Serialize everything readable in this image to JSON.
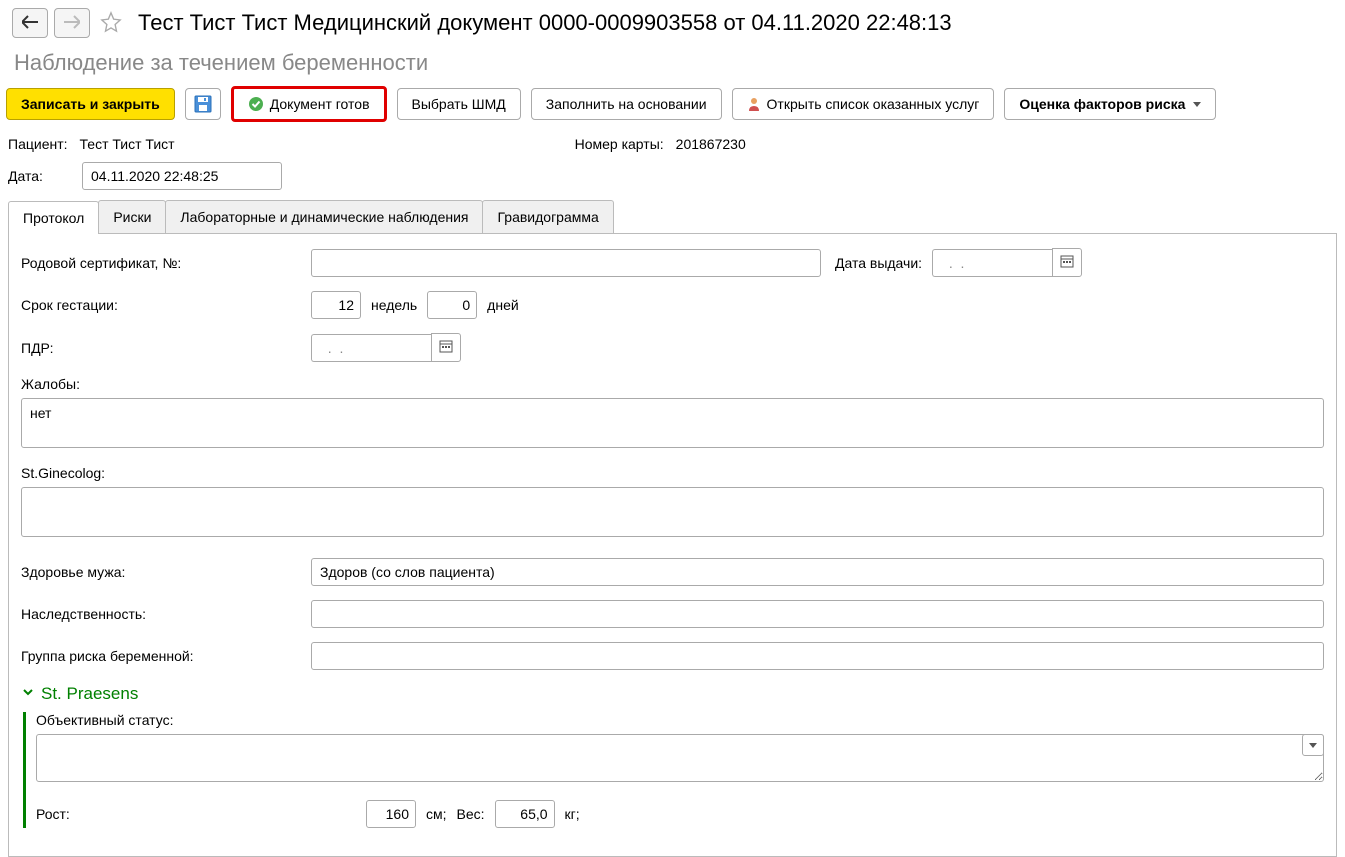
{
  "header": {
    "title": "Тест Тист Тист Медицинский документ 0000-0009903558 от 04.11.2020 22:48:13",
    "subtitle": "Наблюдение за течением беременности"
  },
  "toolbar": {
    "save_close": "Записать и закрыть",
    "doc_ready": "Документ готов",
    "select_shmd": "Выбрать ШМД",
    "fill_based": "Заполнить на основании",
    "open_services": "Открыть список оказанных услуг",
    "risk_assessment": "Оценка факторов риска"
  },
  "patient": {
    "label": "Пациент:",
    "value": "Тест Тист Тист",
    "card_label": "Номер карты:",
    "card_value": "201867230",
    "date_label": "Дата:",
    "date_value": "04.11.2020 22:48:25"
  },
  "tabs": {
    "protocol": "Протокол",
    "risks": "Риски",
    "lab": "Лабораторные и динамические наблюдения",
    "gravid": "Гравидограмма"
  },
  "form": {
    "cert_label": "Родовой сертификат, №:",
    "cert_value": "",
    "issue_date_label": "Дата выдачи:",
    "issue_date_value": "  .  .    ",
    "gest_label": "Срок гестации:",
    "gest_weeks": "12",
    "weeks_unit": "недель",
    "gest_days": "0",
    "days_unit": "дней",
    "pdr_label": "ПДР:",
    "pdr_value": "  .  .    ",
    "complaints_label": "Жалобы:",
    "complaints_value": "нет",
    "ginecolog_label": "St.Ginecolog:",
    "ginecolog_value": "",
    "husband_label": "Здоровье мужа:",
    "husband_value": "Здоров (со слов пациента)",
    "heredity_label": "Наследственность:",
    "heredity_value": "",
    "risk_group_label": "Группа риска беременной:",
    "risk_group_value": "",
    "section_praesens": "St. Praesens",
    "obj_status_label": "Объективный статус:",
    "obj_status_value": "",
    "height_label": "Рост:",
    "height_value": "160",
    "height_unit": "см;",
    "weight_label": "Вес:",
    "weight_value": "65,0",
    "weight_unit": "кг;"
  }
}
